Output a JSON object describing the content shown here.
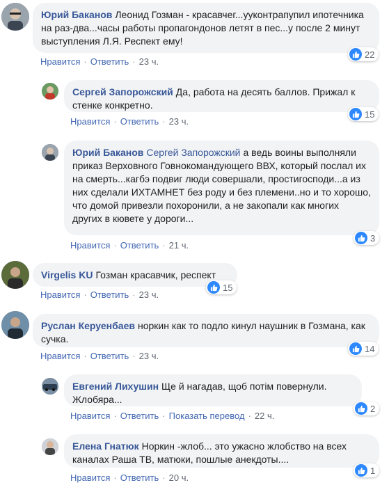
{
  "comments": [
    {
      "author": "Юрий Баканов",
      "text": "Леонид Гозман - красавчег...ууконтрапупил ипотечника на раз-два...часы работы пропагондонов летят в пес...у после 2 минут выступления Л.Я. Респект ему!",
      "likes": "22",
      "like_label": "Нравится",
      "reply_label": "Ответить",
      "time": "23 ч."
    },
    {
      "author": "Сергей Запорожский",
      "text": "Да, работа на десять баллов. Прижал к стенке конкретно.",
      "likes": "15",
      "like_label": "Нравится",
      "reply_label": "Ответить",
      "time": "23 ч."
    },
    {
      "author": "Юрий Баканов",
      "mention": "Сергей Запорожский",
      "text": "а ведь воины выполняли приказ Верховного Говнокомандующего ВВХ, который послал их на смерть...кагбэ подвиг люди совершали, простигосподи...а из них сделали ИХТАМНЕТ без роду и без племени..но и то хорошо, что домой привезли похоронили, а не закопали как многих других в кювете у дороги...",
      "likes": "3",
      "like_label": "Нравится",
      "reply_label": "Ответить",
      "time": "21 ч."
    },
    {
      "author": "Virgelis KU",
      "text": "Гозман красавчик, респект",
      "likes": "15",
      "like_label": "Нравится",
      "reply_label": "Ответить",
      "time": "23 ч."
    },
    {
      "author": "Руслан Керуенбаев",
      "text": "норкин как то подло кинул наушник в Гозмана, как сучка.",
      "likes": "14",
      "like_label": "Нравится",
      "reply_label": "Ответить",
      "time": "23 ч."
    },
    {
      "author": "Евгений Лихушин",
      "text": "Ще й нагадав, щоб потім повернули. Жлобяра...",
      "likes": "2",
      "like_label": "Нравится",
      "reply_label": "Ответить",
      "translate_label": "Показать перевод",
      "time": "22 ч."
    },
    {
      "author": "Елена Гнатюк",
      "text": "Норкин -жлоб... это ужасно жлобство на всех каналах Раша ТВ, матюки, пошлые анекдоты....",
      "likes": "1",
      "like_label": "Нравится",
      "reply_label": "Ответить",
      "time": "20 ч."
    }
  ],
  "colors": {
    "author": "#385898",
    "link": "#4267b2",
    "bubble": "#f2f3f5",
    "like": "#2d88ff"
  },
  "icons": {
    "reaction": "like-icon"
  }
}
